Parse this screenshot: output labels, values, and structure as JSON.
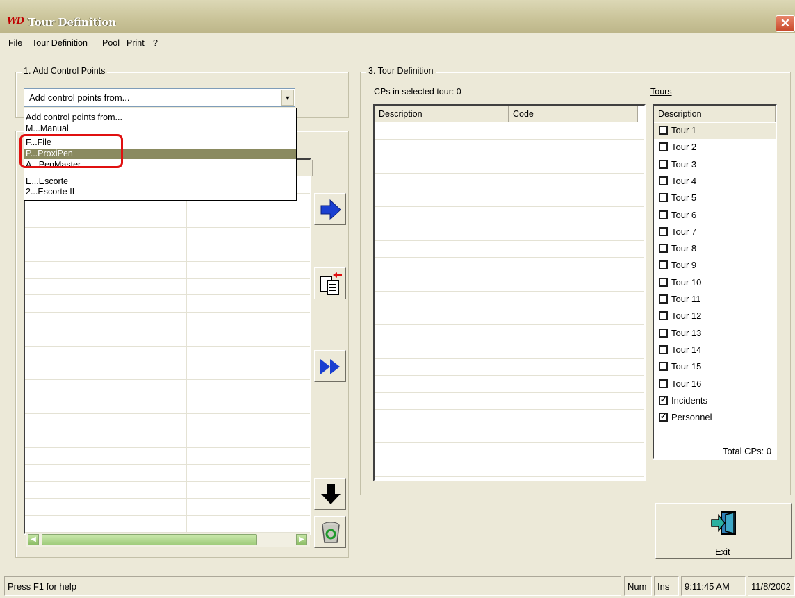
{
  "window": {
    "title": "Tour Definition",
    "logo": "WD",
    "close_label": "✕"
  },
  "menu": [
    "File",
    "Tour Definition",
    "Pool",
    "Print",
    "?"
  ],
  "add_group": {
    "legend": "1. Add Control Points",
    "combo_value": "Add control points from...",
    "options": [
      "Add control points from...",
      "M...Manual",
      "F...File",
      "P...ProxiPen",
      "A...PenMaster",
      "E...Escorte",
      "2...Escorte II"
    ],
    "selected_index": 3
  },
  "tour_group": {
    "legend": "3. Tour Definition",
    "cps_label": "CPs in selected tour: 0",
    "columns": [
      "Description",
      "Code"
    ],
    "tours_label": "Tours",
    "tours_header": "Description",
    "tours": [
      {
        "label": "Tour 1",
        "checked": false
      },
      {
        "label": "Tour 2",
        "checked": false
      },
      {
        "label": "Tour 3",
        "checked": false
      },
      {
        "label": "Tour 4",
        "checked": false
      },
      {
        "label": "Tour 5",
        "checked": false
      },
      {
        "label": "Tour 6",
        "checked": false
      },
      {
        "label": "Tour 7",
        "checked": false
      },
      {
        "label": "Tour 8",
        "checked": false
      },
      {
        "label": "Tour 9",
        "checked": false
      },
      {
        "label": "Tour 10",
        "checked": false
      },
      {
        "label": "Tour 11",
        "checked": false
      },
      {
        "label": "Tour 12",
        "checked": false
      },
      {
        "label": "Tour 13",
        "checked": false
      },
      {
        "label": "Tour 14",
        "checked": false
      },
      {
        "label": "Tour 15",
        "checked": false
      },
      {
        "label": "Tour 16",
        "checked": false
      },
      {
        "label": "Incidents",
        "checked": true
      },
      {
        "label": "Personnel",
        "checked": true
      }
    ],
    "total_cps": "Total CPs: 0"
  },
  "tools": {
    "add_icon": "arrow-right-icon",
    "copy_icon": "paste-icon",
    "add_all_icon": "double-arrow-right-icon",
    "down_icon": "arrow-down-icon",
    "delete_icon": "recycle-bin-icon"
  },
  "exit_label": "Exit",
  "status": {
    "help": "Press F1 for help",
    "num": "Num",
    "ins": "Ins",
    "time": "9:11:45 AM",
    "date": "11/8/2002"
  },
  "colors": {
    "accent_blue": "#1a3fd0",
    "highlight_red": "#e01010",
    "selection": "#8a8a60"
  }
}
